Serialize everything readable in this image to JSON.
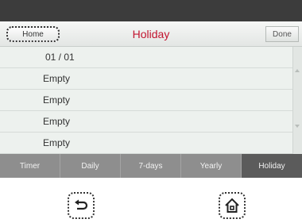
{
  "header": {
    "home_label": "Home",
    "title": "Holiday",
    "done_label": "Done"
  },
  "list": {
    "rows": [
      "01 / 01",
      "Empty",
      "Empty",
      "Empty",
      "Empty"
    ]
  },
  "tabs": [
    {
      "label": "Timer",
      "active": false
    },
    {
      "label": "Daily",
      "active": false
    },
    {
      "label": "7-days",
      "active": false
    },
    {
      "label": "Yearly",
      "active": false
    },
    {
      "label": "Holiday",
      "active": true
    }
  ],
  "hardware_buttons": {
    "back_icon": "back-arrow-icon",
    "home_icon": "home-icon"
  },
  "colors": {
    "title": "#c2142f",
    "tab_bar": "#8e8e8e",
    "tab_active": "#5b5b5b",
    "top_bar": "#3c3c3c"
  }
}
